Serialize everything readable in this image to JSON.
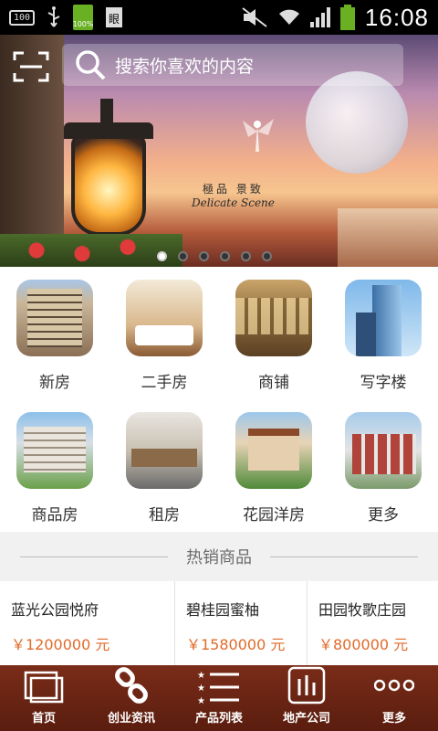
{
  "status_bar": {
    "left_box": "100",
    "battery_pct": "100%",
    "time": "16:08"
  },
  "search": {
    "placeholder": "搜索你喜欢的内容"
  },
  "banner": {
    "caption_cn": "極品 景致",
    "caption_en": "Delicate Scene",
    "slide_count": 6,
    "active_slide": 0
  },
  "categories": [
    {
      "label": "新房",
      "icon": "new-house-photo"
    },
    {
      "label": "二手房",
      "icon": "second-hand-photo"
    },
    {
      "label": "商铺",
      "icon": "shop-photo"
    },
    {
      "label": "写字楼",
      "icon": "office-photo"
    },
    {
      "label": "商品房",
      "icon": "commercial-housing-photo"
    },
    {
      "label": "租房",
      "icon": "rental-photo"
    },
    {
      "label": "花园洋房",
      "icon": "garden-villa-photo"
    },
    {
      "label": "更多",
      "icon": "more-photo"
    }
  ],
  "hot": {
    "title": "热销商品",
    "items": [
      {
        "name": "蓝光公园悦府",
        "price": "￥1200000 元"
      },
      {
        "name": "碧桂园蜜柚",
        "price": "￥1580000 元"
      },
      {
        "name": "田园牧歌庄园",
        "price": "￥800000 元"
      }
    ]
  },
  "nav": [
    {
      "label": "首页",
      "icon": "home-icon"
    },
    {
      "label": "创业资讯",
      "icon": "link-icon"
    },
    {
      "label": "产品列表",
      "icon": "list-icon"
    },
    {
      "label": "地产公司",
      "icon": "chart-icon"
    },
    {
      "label": "更多",
      "icon": "more-icon"
    }
  ],
  "colors": {
    "nav_bg": "#6a2513",
    "price": "#e06a2a"
  }
}
